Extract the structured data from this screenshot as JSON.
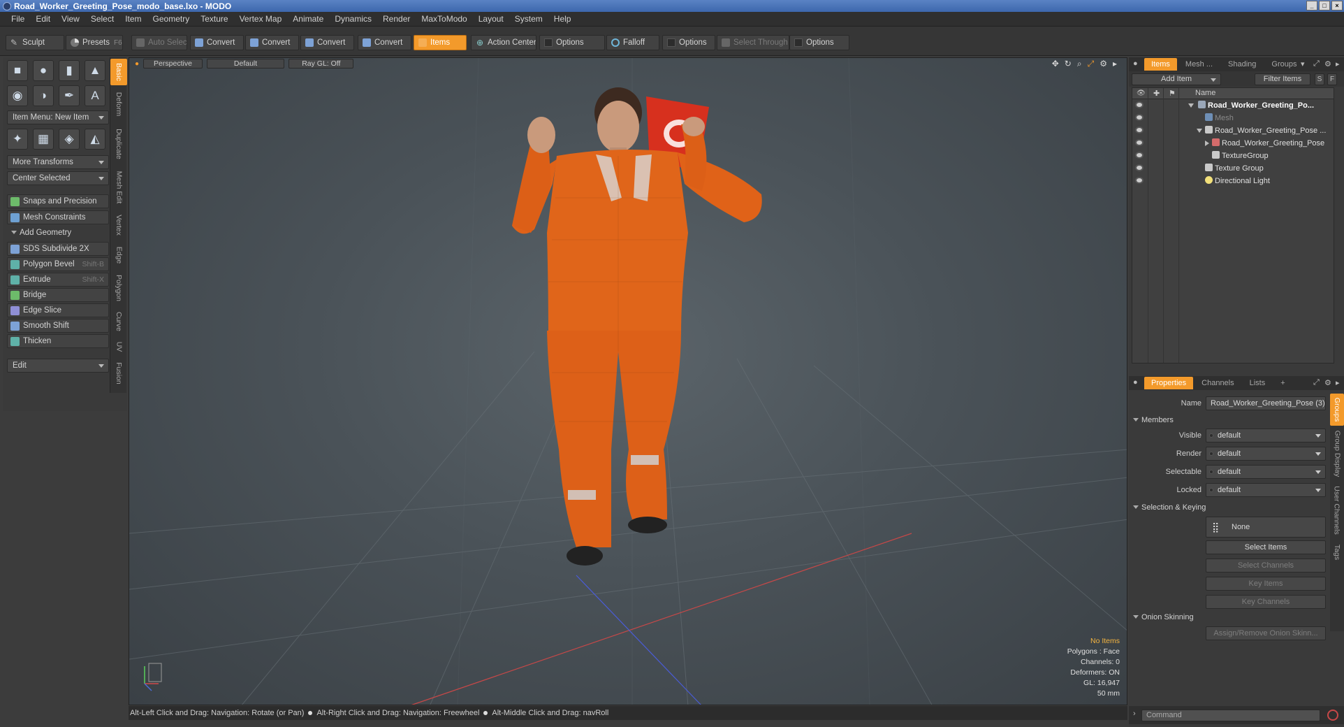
{
  "window": {
    "title": "Road_Worker_Greeting_Pose_modo_base.lxo - MODO"
  },
  "menu": [
    "File",
    "Edit",
    "View",
    "Select",
    "Item",
    "Geometry",
    "Texture",
    "Vertex Map",
    "Animate",
    "Dynamics",
    "Render",
    "MaxToModo",
    "Layout",
    "System",
    "Help"
  ],
  "toolbar": {
    "sculpt": "Sculpt",
    "presets": "Presets",
    "presets_key": "F6",
    "auto_select": "Auto Select",
    "convert1": "Convert",
    "convert2": "Convert",
    "convert3": "Convert",
    "convert4": "Convert",
    "items": "Items",
    "action_center": "Action Center",
    "options1": "Options",
    "falloff": "Falloff",
    "options2": "Options",
    "select_through": "Select Through",
    "options3": "Options"
  },
  "left_panel": {
    "vertical_tabs": [
      "Basic",
      "Deform",
      "Duplicate",
      "Mesh Edit",
      "Vertex",
      "Edge",
      "Polygon",
      "Curve",
      "UV",
      "Fusion"
    ],
    "item_menu": "Item Menu: New Item",
    "more_transforms": "More Transforms",
    "center_selected": "Center Selected",
    "snaps": "Snaps and Precision",
    "mesh_constraints": "Mesh Constraints",
    "add_geometry": "Add Geometry",
    "tools": [
      {
        "label": "SDS Subdivide 2X",
        "shortcut": ""
      },
      {
        "label": "Polygon Bevel",
        "shortcut": "Shift-B"
      },
      {
        "label": "Extrude",
        "shortcut": "Shift-X"
      },
      {
        "label": "Bridge",
        "shortcut": ""
      },
      {
        "label": "Edge Slice",
        "shortcut": ""
      },
      {
        "label": "Smooth Shift",
        "shortcut": ""
      },
      {
        "label": "Thicken",
        "shortcut": ""
      }
    ],
    "edit": "Edit"
  },
  "viewport": {
    "perspective": "Perspective",
    "shading": "Default",
    "raygl": "Ray GL: Off",
    "info": {
      "no_items": "No Items",
      "polygons": "Polygons : Face",
      "channels": "Channels: 0",
      "deformers": "Deformers: ON",
      "gl": "GL: 16,947",
      "focal": "50 mm"
    }
  },
  "status_bar": {
    "hint1": "Alt-Left Click and Drag: Navigation: Rotate (or Pan)",
    "hint2": "Alt-Right Click and Drag: Navigation: Freewheel",
    "hint3": "Alt-Middle Click and Drag: navRoll"
  },
  "items_panel": {
    "tabs": [
      "Items",
      "Mesh ...",
      "Shading",
      "Groups"
    ],
    "add_item": "Add Item",
    "filter_items": "Filter Items",
    "s_button": "S",
    "f_button": "F",
    "name_header": "Name",
    "rows": [
      {
        "name": "Road_Worker_Greeting_Po...",
        "style": "bold",
        "color": "#9aa7b8"
      },
      {
        "name": "Mesh",
        "style": "dim",
        "color": "#6e8fb6"
      },
      {
        "name": "Road_Worker_Greeting_Pose ...",
        "style": "normal",
        "color": "#c9c9c9"
      },
      {
        "name": "Road_Worker_Greeting_Pose",
        "style": "normal",
        "color": "#d46b6b"
      },
      {
        "name": "TextureGroup",
        "style": "normal",
        "color": "#c9c9c9"
      },
      {
        "name": "Texture Group",
        "style": "normal",
        "color": "#c9c9c9"
      },
      {
        "name": "Directional Light",
        "style": "normal",
        "color": "#f2e07a"
      }
    ]
  },
  "properties_panel": {
    "tabs": [
      "Properties",
      "Channels",
      "Lists",
      "+"
    ],
    "name_label": "Name",
    "name_value": "Road_Worker_Greeting_Pose (3)",
    "members": "Members",
    "visible_label": "Visible",
    "visible_value": "default",
    "render_label": "Render",
    "render_value": "default",
    "selectable_label": "Selectable",
    "selectable_value": "default",
    "locked_label": "Locked",
    "locked_value": "default",
    "selection_keying": "Selection & Keying",
    "none": "None",
    "select_items": "Select Items",
    "select_channels": "Select Channels",
    "key_items": "Key Items",
    "key_channels": "Key Channels",
    "onion_skinning": "Onion Skinning",
    "assign_remove": "Assign/Remove Onion Skinn...",
    "vertical_tabs": [
      "Groups",
      "Group Display",
      "User Channels",
      "Tags"
    ],
    "command_placeholder": "Command"
  },
  "colors": {
    "accent": "#f39a2b",
    "suit": "#e0651a"
  }
}
